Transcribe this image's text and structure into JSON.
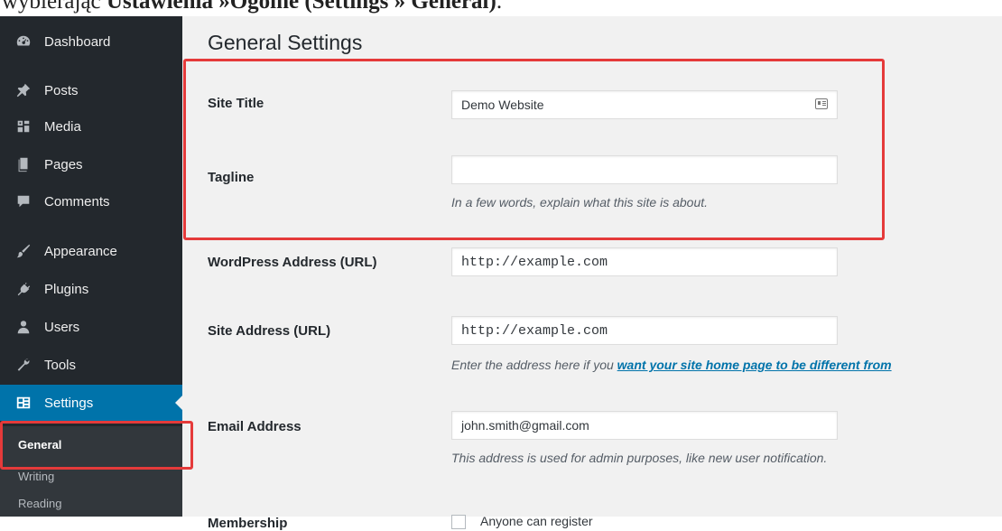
{
  "caption": {
    "prefix": "wybierając ",
    "bold": "Ustawienia »Ogólne (Settings » General)",
    "suffix": "."
  },
  "sidebar": {
    "items": [
      {
        "label": "Dashboard",
        "icon": "dashboard-icon"
      },
      {
        "label": "Posts",
        "icon": "pin-icon"
      },
      {
        "label": "Media",
        "icon": "media-icon"
      },
      {
        "label": "Pages",
        "icon": "pages-icon"
      },
      {
        "label": "Comments",
        "icon": "comment-icon"
      },
      {
        "label": "Appearance",
        "icon": "brush-icon"
      },
      {
        "label": "Plugins",
        "icon": "plug-icon"
      },
      {
        "label": "Users",
        "icon": "users-icon"
      },
      {
        "label": "Tools",
        "icon": "wrench-icon"
      },
      {
        "label": "Settings",
        "icon": "settings-icon"
      }
    ],
    "submenu": [
      "General",
      "Writing",
      "Reading"
    ]
  },
  "main": {
    "title": "General Settings",
    "fields": {
      "site_title": {
        "label": "Site Title",
        "value": "Demo Website"
      },
      "tagline": {
        "label": "Tagline",
        "value": "",
        "description": "In a few words, explain what this site is about."
      },
      "wp_address": {
        "label": "WordPress Address (URL)",
        "value": "http://example.com"
      },
      "site_address": {
        "label": "Site Address (URL)",
        "value": "http://example.com",
        "description_prefix": "Enter the address here if you ",
        "description_link": "want your site home page to be different from"
      },
      "email": {
        "label": "Email Address",
        "value": "john.smith@gmail.com",
        "description": "This address is used for admin purposes, like new user notification."
      },
      "membership": {
        "label": "Membership",
        "checkbox_label": "Anyone can register"
      }
    }
  },
  "colors": {
    "sidebar_bg": "#23282d",
    "active_bg": "#0073aa",
    "highlight": "#e53a3a",
    "main_bg": "#f1f1f1"
  }
}
